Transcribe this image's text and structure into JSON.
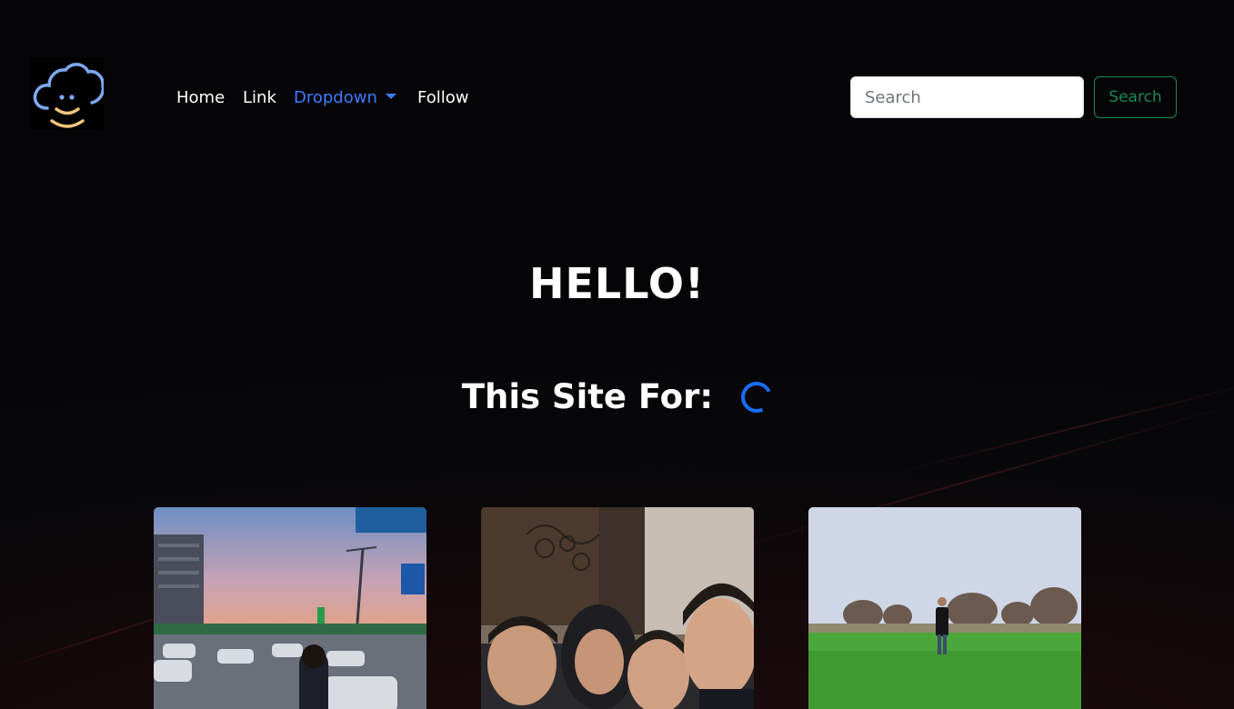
{
  "logo": {
    "name": "cloud-smile-logo",
    "colors": {
      "cloud": "#7fa8f0",
      "smile": "#f2c57c"
    }
  },
  "nav": {
    "items": [
      {
        "label": "Home"
      },
      {
        "label": "Link"
      },
      {
        "label": "Dropdown"
      },
      {
        "label": "Follow"
      }
    ],
    "active_color": "#3d7bff"
  },
  "search": {
    "placeholder": "Search",
    "value": "",
    "button_label": "Search",
    "button_color": "#198754"
  },
  "hero": {
    "title": "HELLO!",
    "subtitle": "This Site For:",
    "spinner_color": "#1a6dff"
  },
  "cards": [
    {
      "image": "sunset-parking-lot-photo"
    },
    {
      "image": "group-selfie-photo"
    },
    {
      "image": "man-on-green-field-photo"
    }
  ]
}
